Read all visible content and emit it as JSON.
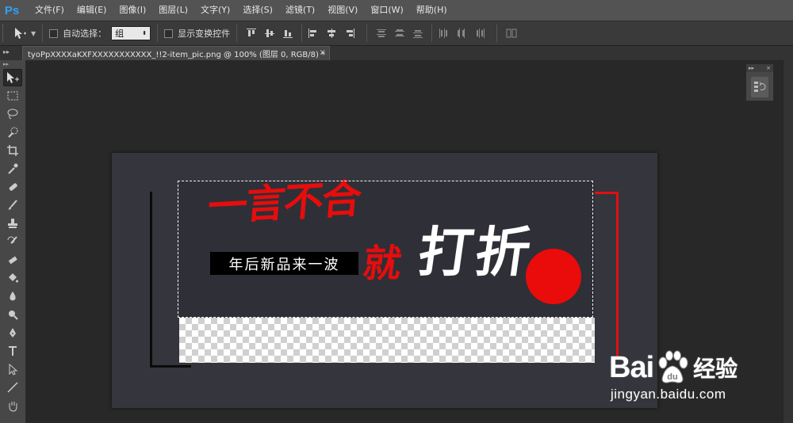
{
  "app": {
    "logo": "Ps",
    "menu": [
      "文件(F)",
      "编辑(E)",
      "图像(I)",
      "图层(L)",
      "文字(Y)",
      "选择(S)",
      "滤镜(T)",
      "视图(V)",
      "窗口(W)",
      "帮助(H)"
    ]
  },
  "options": {
    "tool_icon": "move-tool-icon",
    "auto_select_label": "自动选择：",
    "auto_select_checked": false,
    "auto_select_value": "组",
    "show_transform_label": "显示变换控件",
    "show_transform_checked": false
  },
  "document_tab": {
    "title": "tyoPpXXXXaKXFXXXXXXXXXXX_!!2-item_pic.png @ 100% (图层 0, RGB/8) *",
    "close": "×"
  },
  "panel": {
    "collapse": "▸▸",
    "close": "×"
  },
  "tools": [
    "move-tool",
    "marquee-tool",
    "lasso-tool",
    "quick-select-tool",
    "crop-tool",
    "eyedropper-tool",
    "healing-brush-tool",
    "brush-tool",
    "clone-stamp-tool",
    "history-brush-tool",
    "eraser-tool",
    "paint-bucket-tool",
    "blur-tool",
    "dodge-tool",
    "pen-tool",
    "type-tool",
    "path-select-tool",
    "line-tool",
    "hand-tool"
  ],
  "canvas": {
    "headline": "一言不合",
    "label": "年后新品来一波",
    "jiu": "就",
    "dazhe": "打折"
  },
  "watermark": {
    "bai": "Bai",
    "du": "du",
    "jingyan": "经验",
    "url": "jingyan.baidu.com"
  },
  "colors": {
    "accent_red": "#e60d0d",
    "banner_bg": "#2f2f37",
    "ps_blue": "#2fa3f7"
  }
}
